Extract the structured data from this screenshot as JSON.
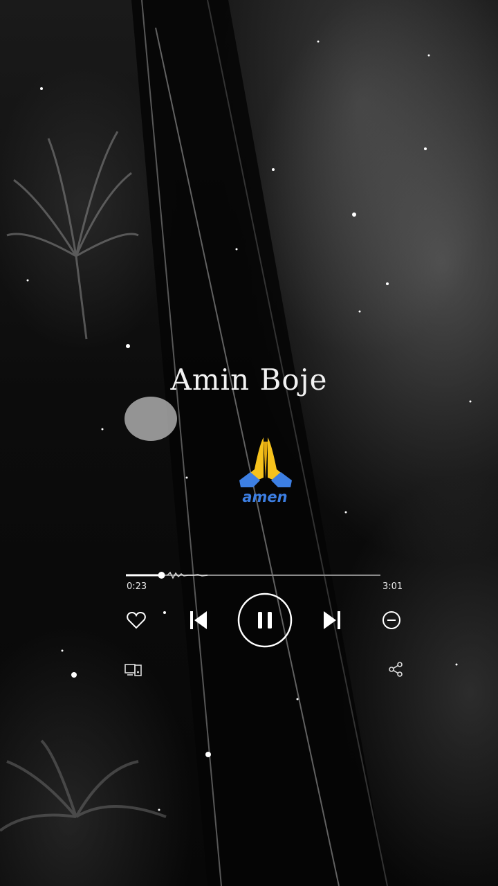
{
  "song": {
    "title": "Amin Boje",
    "artwork_emoji": "folded-hands-icon",
    "artwork_caption": "amen"
  },
  "player": {
    "current_time": "0:23",
    "total_time": "3:01",
    "progress": 0.14,
    "state": "playing"
  },
  "controls": {
    "like": "heart-icon",
    "previous": "skip-previous-icon",
    "play_pause": "pause-icon",
    "next": "skip-next-icon",
    "remove": "minus-circle-icon",
    "devices": "device-icon",
    "share": "share-icon"
  },
  "colors": {
    "text": "#f2f2f2",
    "emoji_yellow": "#f6c21c",
    "emoji_blue": "#3d7fe3"
  }
}
